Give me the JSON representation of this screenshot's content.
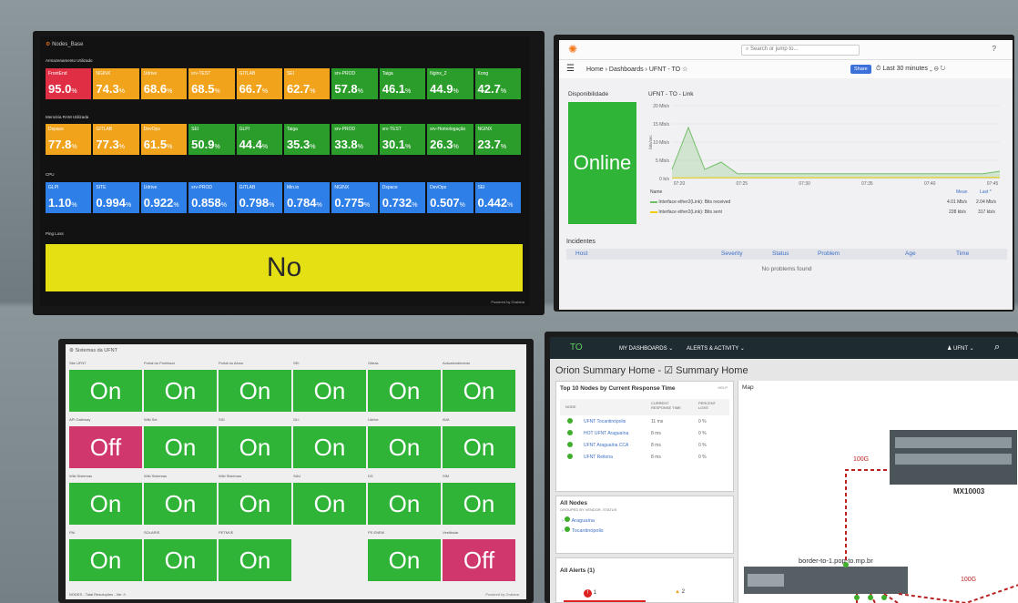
{
  "m1": {
    "title": "Nodes_Base",
    "sec_storage": "Armazenamento Utilizado",
    "sec_ram": "Memória RAM Utilizada",
    "sec_cpu": "CPU",
    "sec_ping": "Ping Loss",
    "ping_value": "No",
    "powered": "Powered by Grafana",
    "storage": [
      {
        "n": "FrontEnd",
        "v": "95.0",
        "u": "%",
        "c": "#e02f44"
      },
      {
        "n": "NGINX",
        "v": "74.3",
        "u": "%",
        "c": "#f0a31b"
      },
      {
        "n": "Udrive",
        "v": "68.6",
        "u": "%",
        "c": "#f0a31b"
      },
      {
        "n": "srv-TEST",
        "v": "68.5",
        "u": "%",
        "c": "#f0a31b"
      },
      {
        "n": "GITLAB",
        "v": "66.7",
        "u": "%",
        "c": "#f0a31b"
      },
      {
        "n": "SEI",
        "v": "62.7",
        "u": "%",
        "c": "#f0a31b"
      },
      {
        "n": "srv-PROD",
        "v": "57.8",
        "u": "%",
        "c": "#2b9d2b"
      },
      {
        "n": "Taiga",
        "v": "46.1",
        "u": "%",
        "c": "#2b9d2b"
      },
      {
        "n": "Nginx_2",
        "v": "44.9",
        "u": "%",
        "c": "#2b9d2b"
      },
      {
        "n": "Kong",
        "v": "42.7",
        "u": "%",
        "c": "#2b9d2b"
      }
    ],
    "ram": [
      {
        "n": "Dspace",
        "v": "77.8",
        "u": "%",
        "c": "#f0a31b"
      },
      {
        "n": "GITLAB",
        "v": "77.3",
        "u": "%",
        "c": "#f0a31b"
      },
      {
        "n": "DevOps",
        "v": "61.5",
        "u": "%",
        "c": "#f0a31b"
      },
      {
        "n": "SEI",
        "v": "50.9",
        "u": "%",
        "c": "#2b9d2b"
      },
      {
        "n": "GLPI",
        "v": "44.4",
        "u": "%",
        "c": "#2b9d2b"
      },
      {
        "n": "Taiga",
        "v": "35.3",
        "u": "%",
        "c": "#2b9d2b"
      },
      {
        "n": "srv-PROD",
        "v": "33.8",
        "u": "%",
        "c": "#2b9d2b"
      },
      {
        "n": "srv-TEST",
        "v": "30.1",
        "u": "%",
        "c": "#2b9d2b"
      },
      {
        "n": "srv-Homologação",
        "v": "26.3",
        "u": "%",
        "c": "#2b9d2b"
      },
      {
        "n": "NGINX",
        "v": "23.7",
        "u": "%",
        "c": "#2b9d2b"
      }
    ],
    "cpu": [
      {
        "n": "GLPI",
        "v": "1.10",
        "u": "%",
        "c": "#2f7fe8"
      },
      {
        "n": "SITE",
        "v": "0.994",
        "u": "%",
        "c": "#2f7fe8"
      },
      {
        "n": "Udrive",
        "v": "0.922",
        "u": "%",
        "c": "#2f7fe8"
      },
      {
        "n": "srv-PROD",
        "v": "0.858",
        "u": "%",
        "c": "#2f7fe8"
      },
      {
        "n": "GITLAB",
        "v": "0.798",
        "u": "%",
        "c": "#2f7fe8"
      },
      {
        "n": "Min.io",
        "v": "0.784",
        "u": "%",
        "c": "#2f7fe8"
      },
      {
        "n": "NGINX",
        "v": "0.775",
        "u": "%",
        "c": "#2f7fe8"
      },
      {
        "n": "Dspace",
        "v": "0.732",
        "u": "%",
        "c": "#2f7fe8"
      },
      {
        "n": "DevOps",
        "v": "0.507",
        "u": "%",
        "c": "#2f7fe8"
      },
      {
        "n": "SEI",
        "v": "0.442",
        "u": "%",
        "c": "#2f7fe8"
      }
    ]
  },
  "m2": {
    "search": "Search or jump to...",
    "crumb": "Home › Dashboards › UFNT - TO ☆",
    "share": "Share",
    "time": "⏱ Last 30 minutes ⌄  ⊖  ↻",
    "disp": "Disponibilidade",
    "online": "Online",
    "link_title": "UFNT - TO - Link",
    "inc_title": "Incidentes",
    "host": "Host",
    "severity": "Severity",
    "status": "Status",
    "problem": "Problem",
    "age": "Age",
    "timecol": "Time",
    "noprob": "No problems found",
    "leg1": "Interface ether2(Link): Bits received",
    "leg2": "Interface ether2(Link): Bits sent",
    "name": "Name",
    "mean": "Mean",
    "last": "Last *",
    "leg1_mean": "4.01 Mb/s",
    "leg1_last": "2.04 Mb/s",
    "leg2_mean": "228 kb/s",
    "leg2_last": "317 kb/s"
  },
  "chart_data": {
    "type": "area",
    "title": "UFNT - TO - Link",
    "ylabel": "bits/sec",
    "yticks": [
      "0 b/s",
      "5 Mb/s",
      "10 Mb/s",
      "15 Mb/s",
      "20 Mb/s"
    ],
    "xticks": [
      "07:20",
      "07:25",
      "07:30",
      "07:35",
      "07:40",
      "07:45"
    ],
    "series": [
      {
        "name": "Interface ether2(Link): Bits received",
        "color": "#73bf69",
        "values": [
          [
            0,
            2.5
          ],
          [
            1,
            14
          ],
          [
            2,
            2.5
          ],
          [
            3,
            4.5
          ],
          [
            4,
            1.3
          ],
          [
            5,
            1.3
          ],
          [
            6,
            1.3
          ],
          [
            7,
            1.3
          ],
          [
            8,
            1.3
          ],
          [
            9,
            1.3
          ],
          [
            10,
            1.3
          ],
          [
            11,
            1.3
          ],
          [
            12,
            1.3
          ],
          [
            13,
            1.3
          ],
          [
            14,
            1.3
          ],
          [
            15,
            1.3
          ],
          [
            16,
            1.3
          ],
          [
            17,
            1.3
          ],
          [
            18,
            1.3
          ],
          [
            19,
            1.3
          ],
          [
            20,
            2
          ]
        ]
      },
      {
        "name": "Interface ether2(Link): Bits sent",
        "color": "#f2cc0c",
        "values": [
          [
            0,
            0.2
          ],
          [
            20,
            0.3
          ]
        ]
      }
    ],
    "ylim": [
      0,
      20
    ]
  },
  "m3": {
    "title": "Sistemas da UFNT",
    "footer": "NODES - Total Resoluções - Ver ⚠",
    "powered": "Powered by Grafana",
    "cells": [
      {
        "l": "Site UFNT",
        "s": "On"
      },
      {
        "l": "Portal do Professor",
        "s": "On"
      },
      {
        "l": "Portal do Aluno",
        "s": "On"
      },
      {
        "l": "SEI",
        "s": "On"
      },
      {
        "l": "Giteas",
        "s": "On"
      },
      {
        "l": "Autoatendimento",
        "s": "On"
      },
      {
        "l": "API Gateway",
        "s": "Off"
      },
      {
        "l": "Wiki Sei",
        "s": "On"
      },
      {
        "l": "SIG",
        "s": "On"
      },
      {
        "l": "GLI",
        "s": "On"
      },
      {
        "l": "Udrive",
        "s": "On"
      },
      {
        "l": "AVA",
        "s": "On"
      },
      {
        "l": "Wiki Sistemas",
        "s": "On"
      },
      {
        "l": "Wiki Sistemas",
        "s": "On"
      },
      {
        "l": "Wiki Sistemas",
        "s": "On"
      },
      {
        "l": "SAU",
        "s": "On"
      },
      {
        "l": "DS",
        "s": "On"
      },
      {
        "l": "SIM",
        "s": "On"
      },
      {
        "l": "PAI",
        "s": "On"
      },
      {
        "l": "SOLARIS",
        "s": "On"
      },
      {
        "l": "PETMVE",
        "s": "On"
      },
      {
        "l": "",
        "s": ""
      },
      {
        "l": "PS ENEM",
        "s": "On"
      },
      {
        "l": "Vestibular",
        "s": "Off"
      }
    ]
  },
  "m4": {
    "logo": "TO",
    "my": "MY DASHBOARDS ⌄",
    "alerts": "ALERTS & ACTIVITY ⌄",
    "user": "♟ UFNT ⌄",
    "title": "Orion Summary Home - ☑ Summary Home",
    "top10": "Top 10 Nodes by Current Response Time",
    "help": "HELP",
    "node": "NODE",
    "crt": "CURRENT RESPONSE TIME",
    "loss": "PERCENT LOSS",
    "rows": [
      {
        "n": "UFNT Tocantinópolis",
        "t": "11 ms",
        "l": "0 %"
      },
      {
        "n": "HOT UFNT Araguaína",
        "t": "8 ms",
        "l": "0 %"
      },
      {
        "n": "UFNT Araguaína CCA",
        "t": "8 ms",
        "l": "0 %"
      },
      {
        "n": "UFNT Reitoria",
        "t": "8 ms",
        "l": "0 %"
      }
    ],
    "allnodes": "All Nodes",
    "grouped": "GROUPED BY VENDOR, STATUS",
    "g1": "Araguaína",
    "g2": "Tocantinópolis",
    "allalerts": "All Alerts (1)",
    "a1": "1",
    "a2": "2",
    "map": "Map",
    "l100a": "100G",
    "l100b": "100G",
    "mx": "MX10003",
    "border": "border-to-1.pop-to.mp.br"
  }
}
